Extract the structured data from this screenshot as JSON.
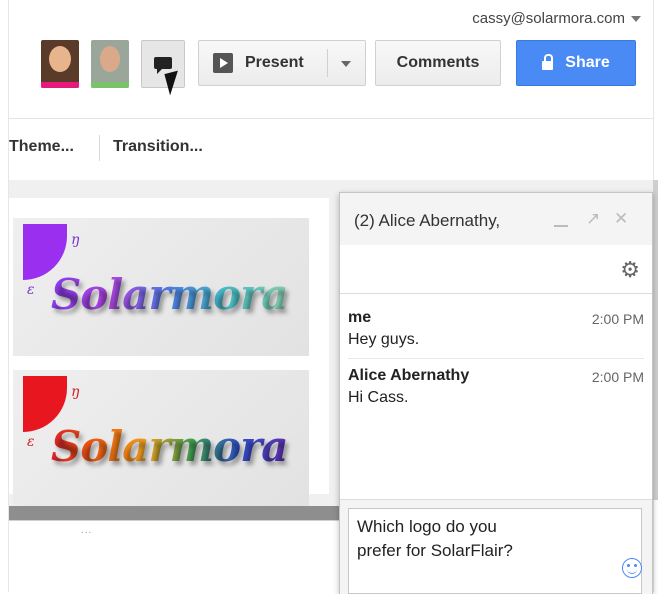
{
  "header": {
    "account_email": "cassy@solarmora.com",
    "collaborators": [
      {
        "color": "#e8197c"
      },
      {
        "color": "#7ac36a"
      }
    ],
    "present_label": "Present",
    "comments_label": "Comments",
    "share_label": "Share",
    "share_color": "#4a8af4"
  },
  "toolbar": {
    "theme_label": "Theme...",
    "transition_label": "Transition..."
  },
  "slides": [
    {
      "logo_text": "Solarmora",
      "sun_color": "#9b2ff0"
    },
    {
      "logo_text": "Solarmora",
      "sun_color": "#e8161e"
    }
  ],
  "notes_grip": "...",
  "chat": {
    "title": "(2) Alice Abernathy,",
    "messages": [
      {
        "sender": "me",
        "time": "2:00 PM",
        "text": "Hey guys."
      },
      {
        "sender": "Alice Abernathy",
        "time": "2:00 PM",
        "text": "Hi Cass."
      }
    ],
    "draft": "Which logo do you\nprefer for SolarFlair?"
  }
}
